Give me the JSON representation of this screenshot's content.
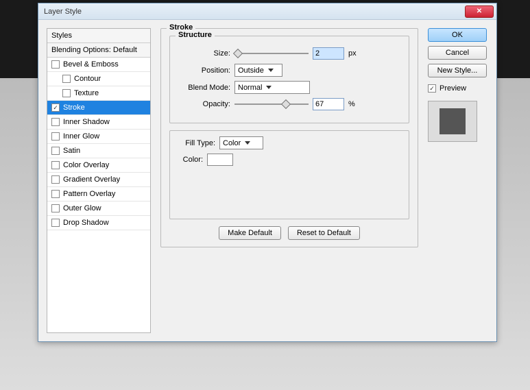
{
  "title": "Layer Style",
  "styles": {
    "header": "Styles",
    "blending": "Blending Options: Default",
    "items": [
      {
        "label": "Bevel & Emboss",
        "checked": false,
        "indent": false,
        "selected": false
      },
      {
        "label": "Contour",
        "checked": false,
        "indent": true,
        "selected": false
      },
      {
        "label": "Texture",
        "checked": false,
        "indent": true,
        "selected": false
      },
      {
        "label": "Stroke",
        "checked": true,
        "indent": false,
        "selected": true
      },
      {
        "label": "Inner Shadow",
        "checked": false,
        "indent": false,
        "selected": false
      },
      {
        "label": "Inner Glow",
        "checked": false,
        "indent": false,
        "selected": false
      },
      {
        "label": "Satin",
        "checked": false,
        "indent": false,
        "selected": false
      },
      {
        "label": "Color Overlay",
        "checked": false,
        "indent": false,
        "selected": false
      },
      {
        "label": "Gradient Overlay",
        "checked": false,
        "indent": false,
        "selected": false
      },
      {
        "label": "Pattern Overlay",
        "checked": false,
        "indent": false,
        "selected": false
      },
      {
        "label": "Outer Glow",
        "checked": false,
        "indent": false,
        "selected": false
      },
      {
        "label": "Drop Shadow",
        "checked": false,
        "indent": false,
        "selected": false
      }
    ]
  },
  "stroke": {
    "legend": "Stroke",
    "structure": {
      "legend": "Structure",
      "size_label": "Size:",
      "size_value": "2",
      "size_unit": "px",
      "position_label": "Position:",
      "position_value": "Outside",
      "blendmode_label": "Blend Mode:",
      "blendmode_value": "Normal",
      "opacity_label": "Opacity:",
      "opacity_value": "67",
      "opacity_unit": "%"
    },
    "fill": {
      "filltype_label": "Fill Type:",
      "filltype_value": "Color",
      "color_label": "Color:"
    },
    "make_default": "Make Default",
    "reset_default": "Reset to Default"
  },
  "buttons": {
    "ok": "OK",
    "cancel": "Cancel",
    "newstyle": "New Style...",
    "preview": "Preview"
  }
}
